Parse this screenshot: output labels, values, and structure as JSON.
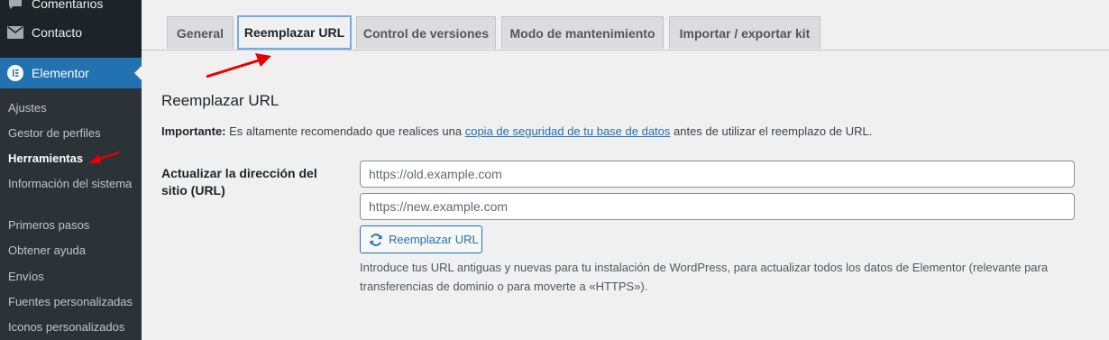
{
  "sidebar": {
    "menu": [
      {
        "label": "Comentarios",
        "icon": "comment-icon"
      },
      {
        "label": "Contacto",
        "icon": "mail-icon"
      },
      {
        "label": "Elementor",
        "icon": "elementor-icon"
      }
    ],
    "submenu": [
      "Ajustes",
      "Gestor de perfiles",
      "Herramientas",
      "Información del sistema",
      "Primeros pasos",
      "Obtener ayuda",
      "Envíos",
      "Fuentes personalizadas",
      "Iconos personalizados"
    ]
  },
  "tabs": [
    "General",
    "Reemplazar URL",
    "Control de versiones",
    "Modo de mantenimiento",
    "Importar / exportar kit"
  ],
  "content": {
    "title": "Reemplazar URL",
    "important_label": "Importante:",
    "important_text_before": " Es altamente recomendado que realices una ",
    "important_link": "copia de seguridad de tu base de datos",
    "important_text_after": " antes de utilizar el reemplazo de URL.",
    "field_label": "Actualizar la dirección del sitio (URL)",
    "old_placeholder": "https://old.example.com",
    "new_placeholder": "https://new.example.com",
    "button_label": "Reemplazar URL",
    "description": "Introduce tus URL antiguas y nuevas para tu instalación de WordPress, para actualizar todos los datos de Elementor (relevante para transferencias de dominio o para moverte a «HTTPS»)."
  },
  "colors": {
    "sidebar_bg": "#1d2327",
    "accent": "#2271b1",
    "annotation_arrow": "#e60000"
  }
}
